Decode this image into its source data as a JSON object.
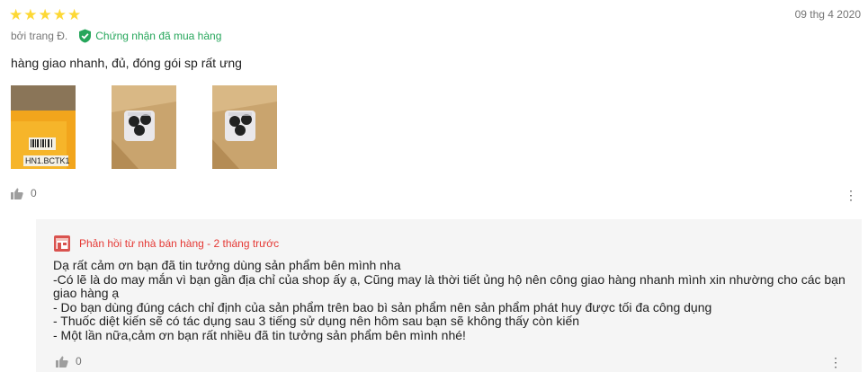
{
  "review": {
    "rating": 5,
    "stars": [
      "★",
      "★",
      "★",
      "★",
      "★"
    ],
    "date": "09 thg 4 2020",
    "author": "bởi trang Đ.",
    "verified_label": "Chứng nhận đã mua hàng",
    "comment": "hàng giao nhanh, đủ, đóng gói sp rất ưng",
    "photos": [
      {
        "label_text": "HN1.BCTK1"
      },
      {
        "label_text": ""
      },
      {
        "label_text": ""
      }
    ],
    "like_count": "0"
  },
  "reply": {
    "header": "Phản hồi từ nhà bán hàng - 2 tháng trước",
    "lines": [
      "Dạ rất cảm ơn bạn đã tin tưởng dùng sản phẩm bên mình nha",
      "-Có lẽ là do may mắn vì bạn gần địa chỉ của shop ấy ạ, Cũng may là thời tiết ủng hộ nên công giao hàng nhanh mình xin nhường cho các bạn giao hàng ạ",
      "- Do bạn dùng đúng cách chỉ định của sản phẩm trên bao bì sản phẩm nên sản phẩm phát huy được tối đa công dụng",
      "- Thuốc diệt kiến sẽ có tác dụng sau 3 tiếng sử dụng nên hôm sau bạn sẽ không thấy còn kiến",
      "- Một lần nữa,cảm ơn bạn rất nhiều đã tin tưởng sản phẩm bên mình nhé!"
    ],
    "like_count": "0"
  },
  "colors": {
    "star": "#fdd835",
    "verified": "#26a65b",
    "reply_header": "#e53935",
    "reply_bg": "#f5f5f5"
  },
  "icons": [
    "star-icon",
    "verified-check-icon",
    "thumbs-up-icon",
    "more-vertical-icon",
    "store-icon"
  ]
}
